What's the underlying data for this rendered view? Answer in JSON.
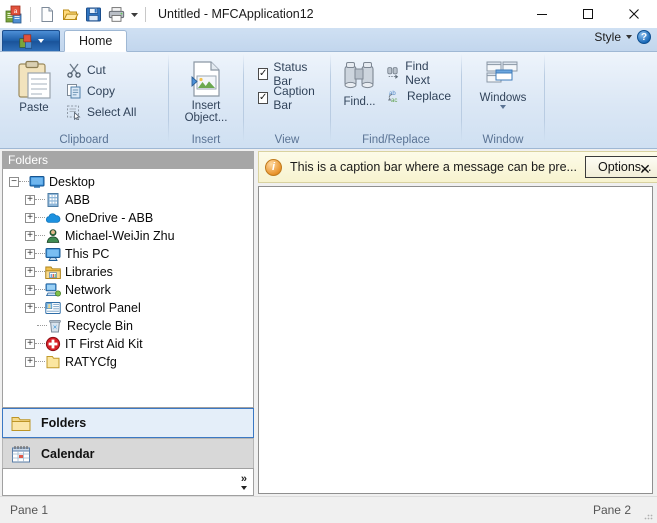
{
  "window": {
    "title": "Untitled - MFCApplication12",
    "minimize_label": "—",
    "maximize_label": "❑",
    "close_label": "✕"
  },
  "quick_access": {
    "app_icon": "mfc-app-icon",
    "items": [
      {
        "name": "new-document-icon",
        "label": "New"
      },
      {
        "name": "open-folder-icon",
        "label": "Open"
      },
      {
        "name": "save-disk-icon",
        "label": "Save"
      },
      {
        "name": "print-icon",
        "label": "Print"
      }
    ],
    "customize_label": "▾"
  },
  "ribbon": {
    "app_button_label": "",
    "tabs": [
      {
        "label": "Home",
        "active": true
      }
    ],
    "style_label": "Style",
    "style_caret": "▾",
    "help_label": "?",
    "groups": [
      {
        "label": "Clipboard",
        "big_button": {
          "label": "Paste",
          "icon": "clipboard-paste-icon"
        },
        "small_buttons": [
          {
            "label": "Cut",
            "icon": "scissors-icon"
          },
          {
            "label": "Copy",
            "icon": "copy-icon"
          },
          {
            "label": "Select All",
            "icon": "select-all-icon"
          }
        ]
      },
      {
        "label": "Insert",
        "big_button": {
          "label": "Insert Object...",
          "icon": "insert-object-icon"
        },
        "small_buttons": []
      },
      {
        "label": "View",
        "checkboxes": [
          {
            "label": "Status Bar",
            "checked": true
          },
          {
            "label": "Caption Bar",
            "checked": true
          }
        ]
      },
      {
        "label": "Find/Replace",
        "big_button": {
          "label": "Find...",
          "icon": "binoculars-icon"
        },
        "small_buttons": [
          {
            "label": "Find Next",
            "icon": "find-next-icon"
          },
          {
            "label": "Replace",
            "icon": "replace-icon"
          }
        ]
      },
      {
        "label": "Window",
        "big_button": {
          "label": "Windows",
          "icon": "windows-tile-icon",
          "has_dropdown": true
        },
        "small_buttons": []
      }
    ]
  },
  "left_pane": {
    "caption": "Folders",
    "tree": [
      {
        "label": "Desktop",
        "indent": 0,
        "toggle": "minus",
        "icon": "desktop-icon"
      },
      {
        "label": "ABB",
        "indent": 1,
        "toggle": "plus",
        "icon": "building-icon"
      },
      {
        "label": "OneDrive - ABB",
        "indent": 1,
        "toggle": "plus",
        "icon": "onedrive-cloud-icon"
      },
      {
        "label": "Michael-WeiJin Zhu",
        "indent": 1,
        "toggle": "plus",
        "icon": "user-icon"
      },
      {
        "label": "This PC",
        "indent": 1,
        "toggle": "plus",
        "icon": "this-pc-icon"
      },
      {
        "label": "Libraries",
        "indent": 1,
        "toggle": "plus",
        "icon": "libraries-icon"
      },
      {
        "label": "Network",
        "indent": 1,
        "toggle": "plus",
        "icon": "network-icon"
      },
      {
        "label": "Control Panel",
        "indent": 1,
        "toggle": "plus",
        "icon": "control-panel-icon"
      },
      {
        "label": "Recycle Bin",
        "indent": 1,
        "toggle": "none",
        "icon": "recycle-bin-icon"
      },
      {
        "label": "IT First Aid Kit",
        "indent": 1,
        "toggle": "plus",
        "icon": "first-aid-icon"
      },
      {
        "label": "RATYCfg",
        "indent": 1,
        "toggle": "plus",
        "icon": "folder-icon"
      }
    ],
    "buttons": [
      {
        "label": "Folders",
        "icon": "folder-icon",
        "selected": true
      },
      {
        "label": "Calendar",
        "icon": "calendar-icon",
        "selected": false
      }
    ],
    "more_label": "»",
    "more_caret": "▾"
  },
  "caption_bar": {
    "icon": "info-icon",
    "message": "This is a caption bar where a message can be pre...",
    "button_label": "Options...",
    "close_label": "✕"
  },
  "status_bar": {
    "left": "Pane 1",
    "right": "Pane 2"
  }
}
